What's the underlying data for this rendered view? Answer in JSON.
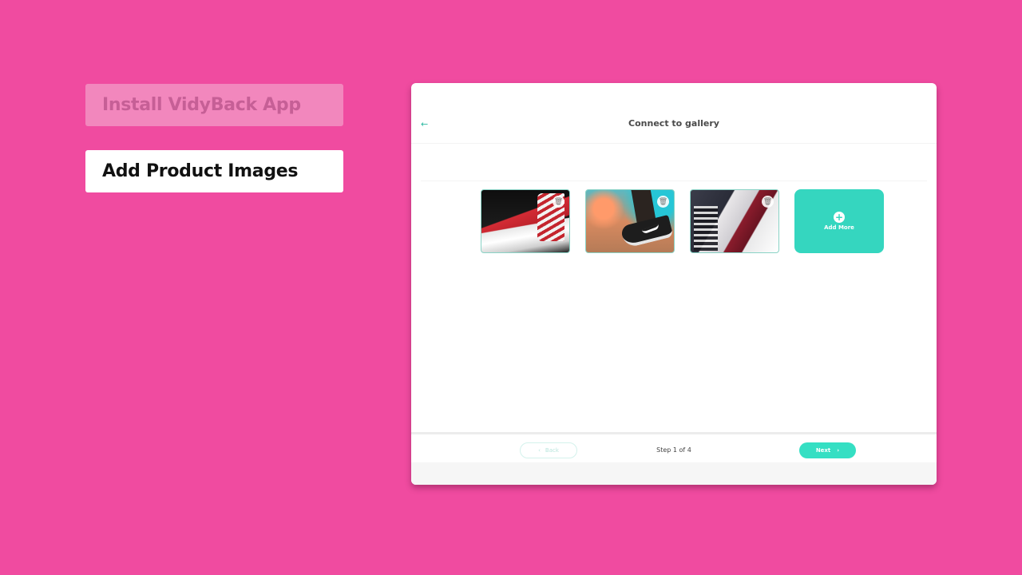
{
  "steps": [
    {
      "label": "Install VidyBack App",
      "state": "inactive"
    },
    {
      "label": "Add Product Images",
      "state": "active"
    }
  ],
  "window": {
    "title": "Connect to gallery",
    "back_icon": "arrow-left-icon",
    "gallery": {
      "images": [
        {
          "alt": "Red and white canvas sneakers with laces",
          "delete_icon": "trash-icon"
        },
        {
          "alt": "Black Nike skate shoe on colorful background",
          "delete_icon": "trash-icon"
        },
        {
          "alt": "Pile of assorted canvas sneakers",
          "delete_icon": "trash-icon"
        }
      ],
      "add_more": {
        "label": "Add More",
        "icon": "plus-circle-icon"
      }
    },
    "footer": {
      "back_label": "Back",
      "back_icon": "chevron-left-icon",
      "step_text": "Step 1 of 4",
      "next_label": "Next",
      "next_icon": "chevron-right-icon"
    }
  },
  "colors": {
    "background": "#f04ba0",
    "accent": "#35d6bf"
  }
}
